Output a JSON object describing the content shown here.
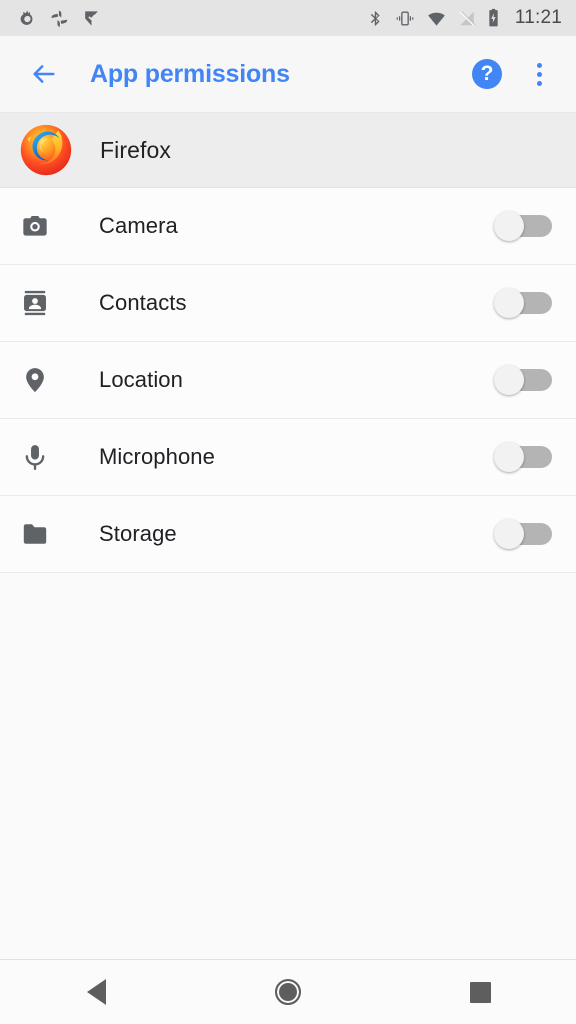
{
  "status_bar": {
    "time": "11:21",
    "notification_icons": [
      "firefox-icon",
      "photos-icon",
      "checkmark-flag-icon"
    ],
    "system_icons": [
      "bluetooth-icon",
      "vibrate-icon",
      "wifi-icon",
      "no-sim-icon",
      "battery-charging-icon"
    ],
    "background_color": "#E4E4E4"
  },
  "toolbar": {
    "back_label": "Back",
    "title": "App permissions",
    "help_label": "?",
    "overflow_label": "More options",
    "accent_color": "#4285F4"
  },
  "app_header": {
    "name": "Firefox",
    "icon": "firefox-logo"
  },
  "permissions": [
    {
      "label": "Camera",
      "icon": "camera-icon",
      "enabled": false
    },
    {
      "label": "Contacts",
      "icon": "contacts-icon",
      "enabled": false
    },
    {
      "label": "Location",
      "icon": "location-pin-icon",
      "enabled": false
    },
    {
      "label": "Microphone",
      "icon": "microphone-icon",
      "enabled": false
    },
    {
      "label": "Storage",
      "icon": "folder-icon",
      "enabled": false
    }
  ],
  "nav_bar": {
    "back_label": "Back",
    "home_label": "Home",
    "recents_label": "Recents"
  }
}
